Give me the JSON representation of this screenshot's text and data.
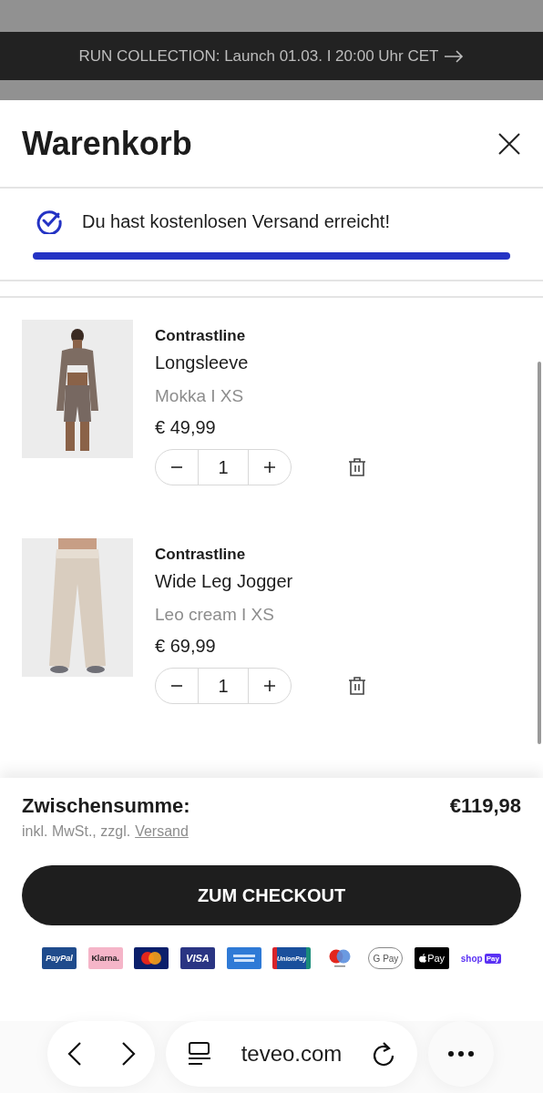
{
  "announcement": {
    "text": "RUN COLLECTION: Launch 01.03. I 20:00 Uhr CET"
  },
  "cart": {
    "title": "Warenkorb"
  },
  "shipping": {
    "message": "Du hast kostenlosen Versand erreicht!",
    "level": 1
  },
  "items": [
    {
      "brand": "Contrastline",
      "name": "Longsleeve",
      "variant": "Mokka I XS",
      "price": "€ 49,99",
      "quantity": "1",
      "kind": "top"
    },
    {
      "brand": "Contrastline",
      "name": "Wide Leg Jogger",
      "variant": "Leo cream I XS",
      "price": "€ 69,99",
      "quantity": "1",
      "kind": "pants"
    }
  ],
  "summary": {
    "label": "Zwischensumme:",
    "amount": "€119,98",
    "note": "inkl. MwSt., zzgl.",
    "note_link": "Versand"
  },
  "checkout_button": "ZUM CHECKOUT",
  "payment_methods": [
    {
      "kind": "paypal",
      "label": "PayPal"
    },
    {
      "kind": "klarna",
      "label": "Klarna."
    },
    {
      "kind": "mastercard"
    },
    {
      "kind": "visa",
      "label": "VISA"
    },
    {
      "kind": "amex"
    },
    {
      "kind": "unionpay",
      "label": "UnionPay"
    },
    {
      "kind": "maestro"
    },
    {
      "kind": "gpay",
      "label": "G Pay"
    },
    {
      "kind": "applepay",
      "label": "Pay"
    },
    {
      "kind": "shoppay",
      "label": "shop",
      "tag": "Pay"
    }
  ],
  "browser": {
    "url": "teveo.com"
  }
}
